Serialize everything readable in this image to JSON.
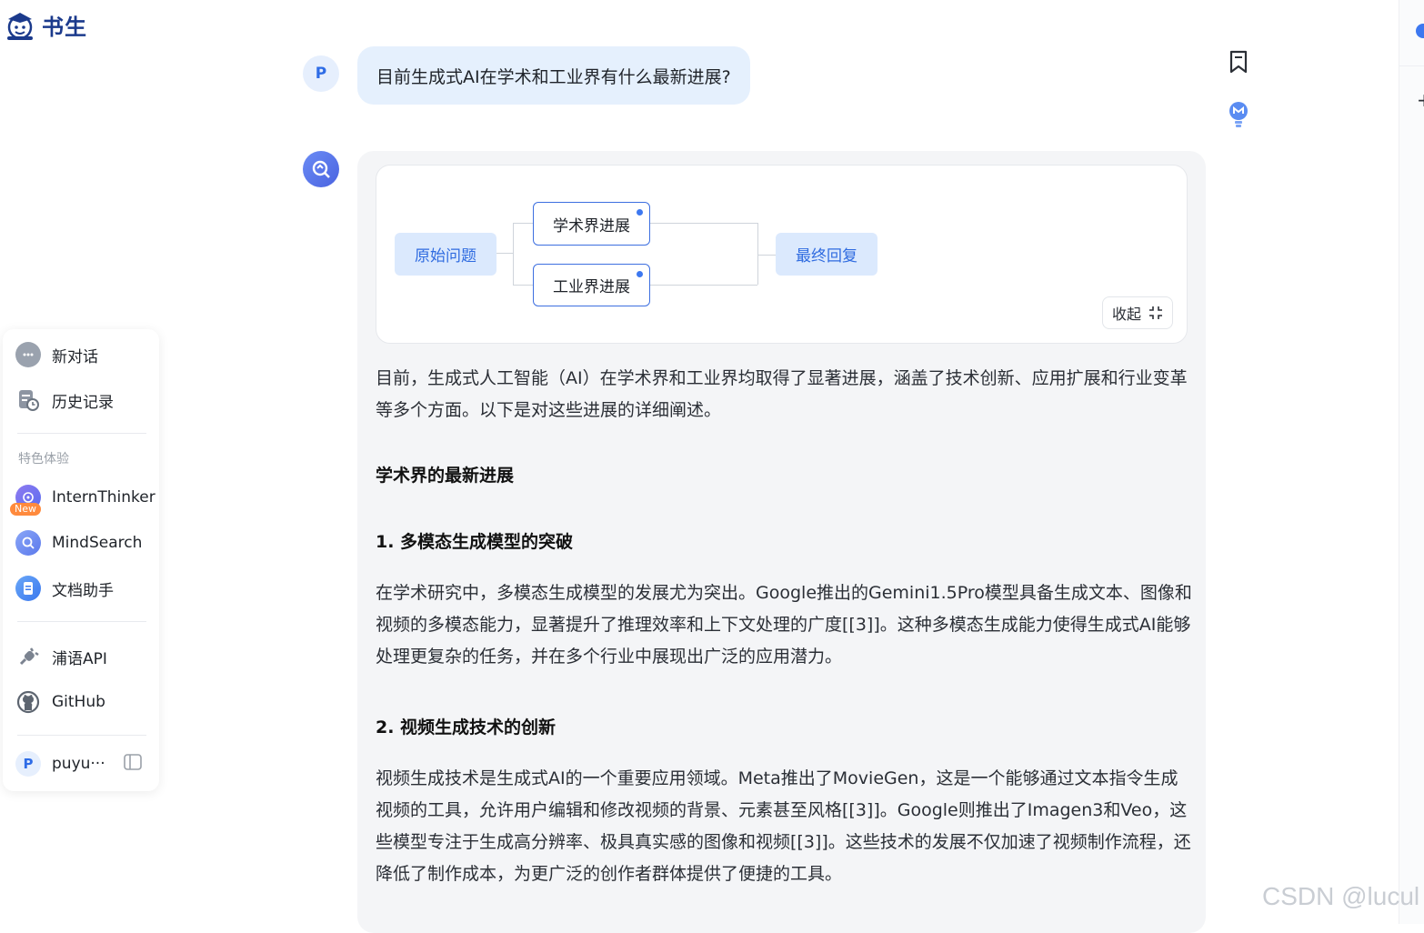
{
  "app": {
    "name": "书生"
  },
  "sidebar": {
    "new_chat": "新对话",
    "history": "历史记录",
    "section_title": "特色体验",
    "features": [
      {
        "label": "InternThinker",
        "badge": "New"
      },
      {
        "label": "MindSearch"
      },
      {
        "label": "文档助手"
      }
    ],
    "links": [
      {
        "label": "浦语API"
      },
      {
        "label": "GitHub"
      }
    ],
    "user": {
      "initial": "P",
      "name": "puyu···"
    }
  },
  "chat": {
    "user_initial": "P",
    "question": "目前生成式AI在学术和工业界有什么最新进展?",
    "flow": {
      "origin": "原始问题",
      "branch1": "学术界进展",
      "branch2": "工业界进展",
      "final": "最终回复",
      "collapse": "收起"
    },
    "answer": {
      "intro": "目前，生成式人工智能（AI）在学术界和工业界均取得了显著进展，涵盖了技术创新、应用扩展和行业变革等多个方面。以下是对这些进展的详细阐述。",
      "section1": "学术界的最新进展",
      "sub1": "1. 多模态生成模型的突破",
      "para1": "在学术研究中，多模态生成模型的发展尤为突出。Google推出的Gemini1.5Pro模型具备生成文本、图像和视频的多模态能力，显著提升了推理效率和上下文处理的广度[[3]]。这种多模态生成能力使得生成式AI能够处理更复杂的任务，并在多个行业中展现出广泛的应用潜力。",
      "sub2": "2. 视频生成技术的创新",
      "para2": "视频生成技术是生成式AI的一个重要应用领域。Meta推出了MovieGen，这是一个能够通过文本指令生成视频的工具，允许用户编辑和修改视频的背景、元素甚至风格[[3]]。Google则推出了Imagen3和Veo，这些模型专注于生成高分辨率、极具真实感的图像和视频[[3]]。这些技术的发展不仅加速了视频制作流程，还降低了制作成本，为更广泛的创作者群体提供了便捷的工具。"
    }
  },
  "watermark": "CSDN @lucul",
  "colors": {
    "accent": "#2f6be0",
    "bubble": "#e5f0fd",
    "panel": "#f4f5f7"
  }
}
